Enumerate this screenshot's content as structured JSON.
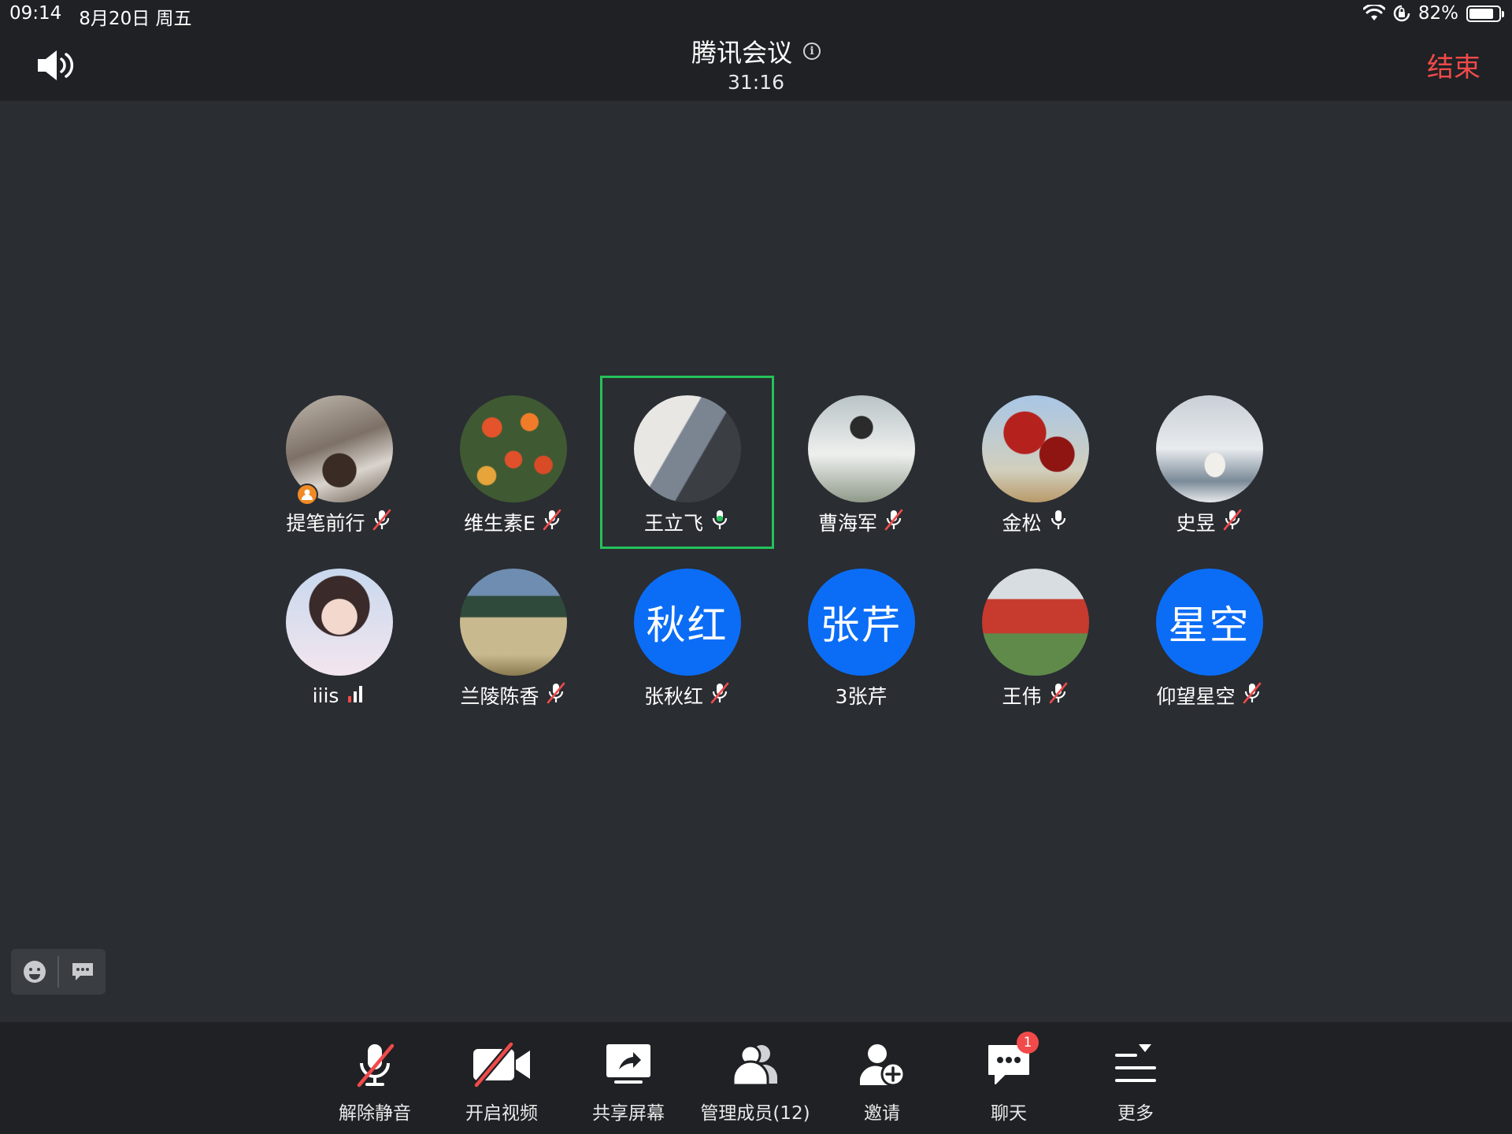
{
  "status_bar": {
    "time": "09:14",
    "date": "8月20日 周五",
    "battery_percent": "82%",
    "battery_level": 0.82
  },
  "header": {
    "title": "腾讯会议",
    "timer": "31:16",
    "end_label": "结束"
  },
  "participants": [
    {
      "name": "提笔前行",
      "avatar_text": "",
      "mic": "muted",
      "host": true,
      "speaking": false,
      "photo": "ph1"
    },
    {
      "name": "维生素E",
      "avatar_text": "",
      "mic": "muted",
      "host": false,
      "speaking": false,
      "photo": "ph2"
    },
    {
      "name": "王立飞",
      "avatar_text": "",
      "mic": "active",
      "host": false,
      "speaking": true,
      "photo": "ph3"
    },
    {
      "name": "曹海军",
      "avatar_text": "",
      "mic": "muted",
      "host": false,
      "speaking": false,
      "photo": "ph4"
    },
    {
      "name": "金松",
      "avatar_text": "",
      "mic": "on",
      "host": false,
      "speaking": false,
      "photo": "ph5"
    },
    {
      "name": "史昱",
      "avatar_text": "",
      "mic": "muted",
      "host": false,
      "speaking": false,
      "photo": "ph6"
    },
    {
      "name": "iiis",
      "avatar_text": "",
      "mic": "signal",
      "host": false,
      "speaking": false,
      "photo": "ph7"
    },
    {
      "name": "兰陵陈香",
      "avatar_text": "",
      "mic": "muted",
      "host": false,
      "speaking": false,
      "photo": "ph8"
    },
    {
      "name": "张秋红",
      "avatar_text": "秋红",
      "mic": "muted",
      "host": false,
      "speaking": false,
      "photo": ""
    },
    {
      "name": "3张芹",
      "avatar_text": "张芹",
      "mic": "none",
      "host": false,
      "speaking": false,
      "photo": ""
    },
    {
      "name": "王伟",
      "avatar_text": "",
      "mic": "muted",
      "host": false,
      "speaking": false,
      "photo": "ph9"
    },
    {
      "name": "仰望星空",
      "avatar_text": "星空",
      "mic": "muted",
      "host": false,
      "speaking": false,
      "photo": ""
    }
  ],
  "toolbar": {
    "unmute": "解除静音",
    "video": "开启视频",
    "share": "共享屏幕",
    "members": "管理成员(12)",
    "invite": "邀请",
    "chat": "聊天",
    "chat_badge": "1",
    "more": "更多"
  },
  "colors": {
    "background": "#2a2d32",
    "bar": "#1f2124",
    "accent_blue": "#0b6df6",
    "end_red": "#f04a4a",
    "speaking_green": "#25c25a",
    "mute_red": "#f04a4a"
  },
  "icons": {
    "speaker": "speaker-icon",
    "info": "info-icon",
    "emoji": "emoji-icon",
    "danmaku": "danmaku-icon"
  }
}
